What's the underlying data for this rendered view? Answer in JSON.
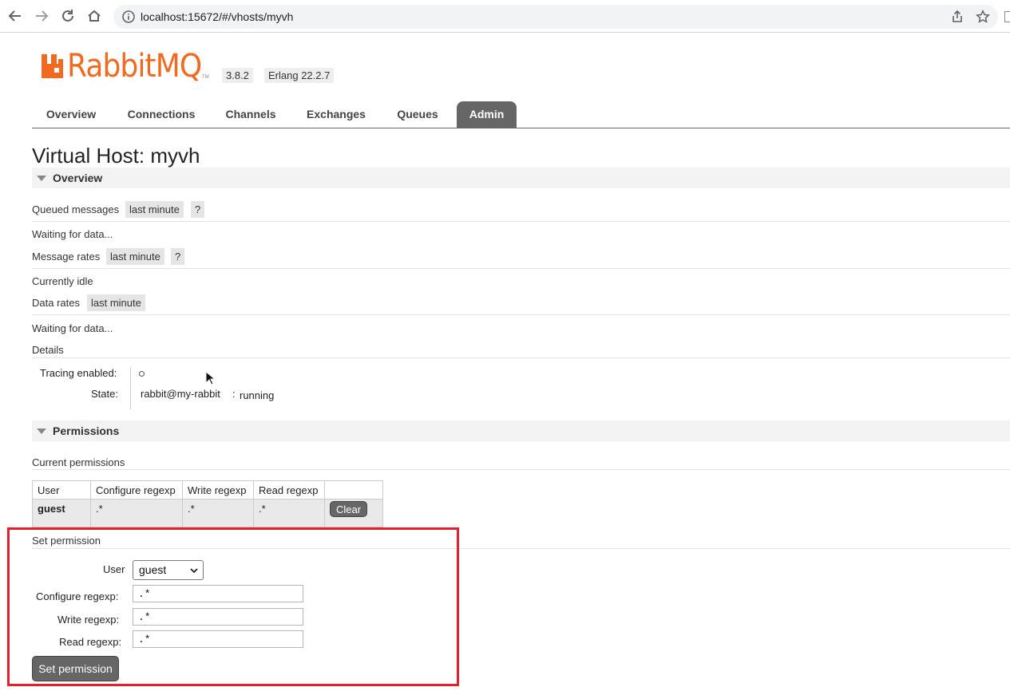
{
  "browser": {
    "url": "localhost:15672/#/vhosts/myvh"
  },
  "header": {
    "logo_text": "RabbitMQ",
    "logo_tm": "TM",
    "version": "3.8.2",
    "erlang": "Erlang 22.2.7",
    "brand_color": "#f06a22"
  },
  "tabs": [
    {
      "label": "Overview"
    },
    {
      "label": "Connections"
    },
    {
      "label": "Channels"
    },
    {
      "label": "Exchanges"
    },
    {
      "label": "Queues"
    },
    {
      "label": "Admin",
      "active": true
    }
  ],
  "page_title": "Virtual Host: myvh",
  "overview": {
    "header": "Overview",
    "queued_messages_label": "Queued messages",
    "queued_range": "last minute",
    "help": "?",
    "queued_status": "Waiting for data...",
    "message_rates_label": "Message rates",
    "rates_range": "last minute",
    "rates_status": "Currently idle",
    "data_rates_label": "Data rates",
    "data_range": "last minute",
    "data_status": "Waiting for data...",
    "details_label": "Details",
    "tracing_label": "Tracing enabled:",
    "tracing_value": "○",
    "state_label": "State:",
    "state_node": "rabbit@my-rabbit",
    "state_sep": ":",
    "state_value": "running"
  },
  "permissions": {
    "header": "Permissions",
    "current_label": "Current permissions",
    "columns": [
      "User",
      "Configure regexp",
      "Write regexp",
      "Read regexp"
    ],
    "rows": [
      {
        "user": "guest",
        "configure": ".*",
        "write": ".*",
        "read": ".*",
        "action": "Clear"
      }
    ],
    "set_label": "Set permission",
    "form": {
      "user_label": "User",
      "user_value": "guest",
      "configure_label": "Configure regexp:",
      "configure_value": ".*",
      "write_label": "Write regexp:",
      "write_value": ".*",
      "read_label": "Read regexp:",
      "read_value": ".*",
      "submit_label": "Set permission"
    }
  },
  "highlight_color": "#e3212c"
}
